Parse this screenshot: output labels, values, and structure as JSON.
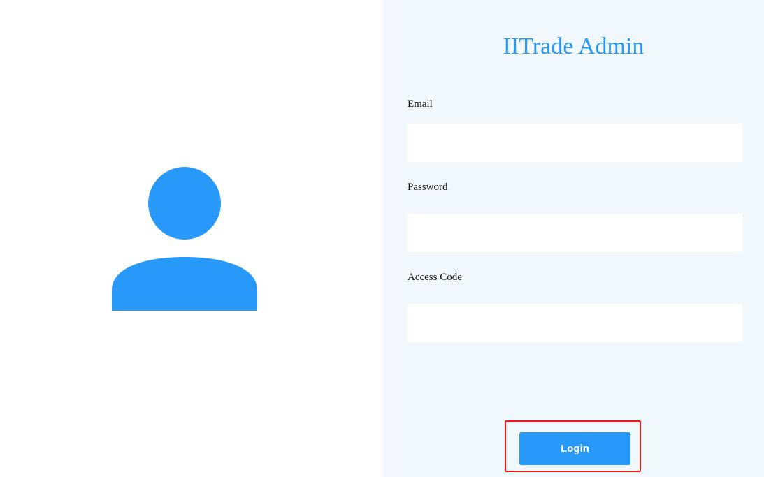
{
  "app_title": "IITrade Admin",
  "form": {
    "email_label": "Email",
    "email_value": "",
    "password_label": "Password",
    "password_value": "",
    "access_code_label": "Access Code",
    "access_code_value": "",
    "login_label": "Login"
  },
  "icons": {
    "avatar": "user-icon"
  },
  "colors": {
    "accent": "#2899f8",
    "panel_bg": "#f0f7fd",
    "highlight": "#f01c14"
  }
}
